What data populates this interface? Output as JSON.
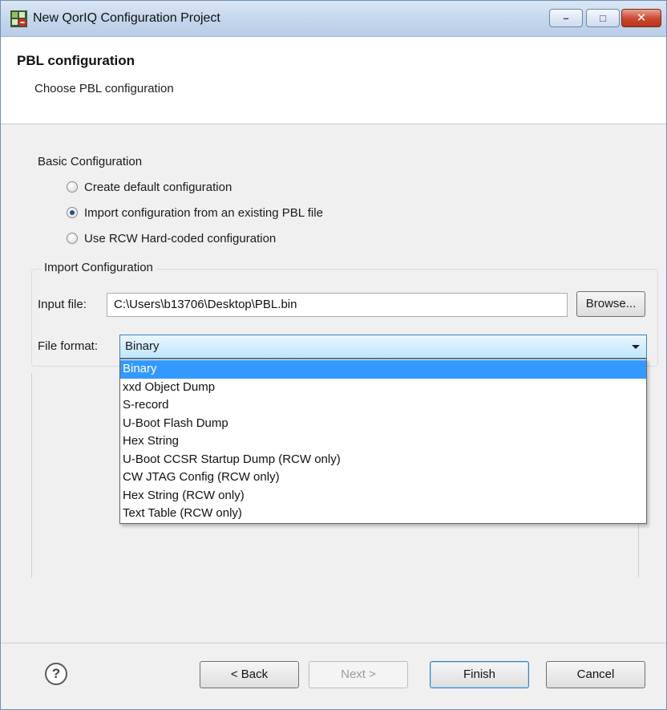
{
  "window": {
    "title": "New QorIQ Configuration Project",
    "controls": {
      "minimize": "–",
      "maximize": "□",
      "close": "✕"
    }
  },
  "header": {
    "title": "PBL configuration",
    "subtitle": "Choose PBL configuration"
  },
  "basic_config": {
    "label": "Basic Configuration",
    "options": [
      {
        "label": "Create default configuration",
        "checked": false
      },
      {
        "label": "Import configuration from an existing PBL file",
        "checked": true
      },
      {
        "label": "Use RCW Hard-coded configuration",
        "checked": false
      }
    ]
  },
  "import_config": {
    "group_label": "Import Configuration",
    "input_file_label": "Input file:",
    "input_file_value": "C:\\Users\\b13706\\Desktop\\PBL.bin",
    "browse_label": "Browse...",
    "file_format_label": "File format:",
    "file_format_value": "Binary",
    "file_format_options": [
      "Binary",
      "xxd Object Dump",
      "S-record",
      "U-Boot Flash Dump",
      "Hex String",
      "U-Boot CCSR Startup Dump (RCW only)",
      "CW JTAG Config (RCW only)",
      "Hex String (RCW only)",
      "Text Table (RCW only)"
    ],
    "highlighted_option": "Binary"
  },
  "footer": {
    "help_icon": "?",
    "back_label": "< Back",
    "next_label": "Next >",
    "finish_label": "Finish",
    "cancel_label": "Cancel"
  },
  "colors": {
    "highlight": "#3399ff",
    "title_bar": "#c4d6ec",
    "close_button": "#c9462f"
  }
}
